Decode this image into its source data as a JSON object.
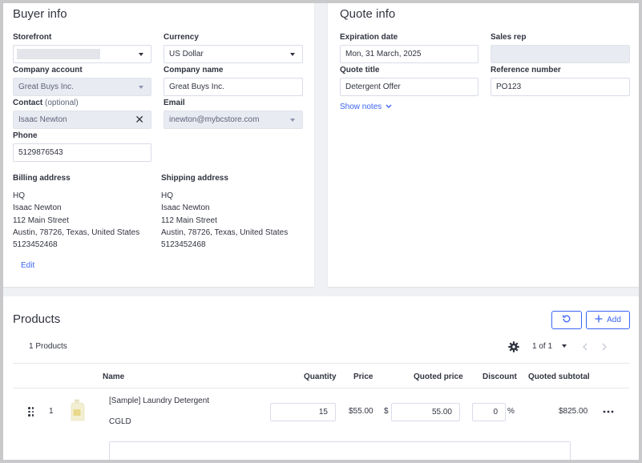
{
  "buyer": {
    "title": "Buyer info",
    "storefront_label": "Storefront",
    "currency_label": "Currency",
    "currency_value": "US Dollar",
    "company_account_label": "Company account",
    "company_account_value": "Great Buys Inc.",
    "company_name_label": "Company name",
    "company_name_value": "Great Buys Inc.",
    "contact_label": "Contact",
    "contact_optional": "(optional)",
    "contact_value": "Isaac Newton",
    "email_label": "Email",
    "email_value": "inewton@mybcstore.com",
    "phone_label": "Phone",
    "phone_value": "5129876543",
    "billing_label": "Billing address",
    "shipping_label": "Shipping address",
    "billing": [
      "HQ",
      "Isaac Newton",
      "112 Main Street",
      "Austin, 78726, Texas, United States",
      "5123452468"
    ],
    "shipping": [
      "HQ",
      "Isaac Newton",
      "112 Main Street",
      "Austin, 78726, Texas, United States",
      "5123452468"
    ],
    "edit_label": "Edit"
  },
  "quote": {
    "title": "Quote info",
    "expiration_label": "Expiration date",
    "expiration_value": "Mon, 31 March, 2025",
    "sales_rep_label": "Sales rep",
    "quote_title_label": "Quote title",
    "quote_title_value": "Detergent Offer",
    "reference_label": "Reference number",
    "reference_value": "PO123",
    "show_notes": "Show notes"
  },
  "products": {
    "title": "Products",
    "add_label": "Add",
    "count_text": "1 Products",
    "pagination": "1 of 1",
    "columns": {
      "name": "Name",
      "quantity": "Quantity",
      "price": "Price",
      "quoted_price": "Quoted price",
      "discount": "Discount",
      "quoted_subtotal": "Quoted subtotal"
    },
    "rows": [
      {
        "index": "1",
        "name": "[Sample] Laundry Detergent",
        "sku": "CGLD",
        "quantity": "15",
        "price": "$55.00",
        "currency_symbol": "$",
        "quoted_price": "55.00",
        "discount": "0",
        "percent": "%",
        "subtotal": "$825.00"
      }
    ]
  },
  "icons": {
    "clear": "close-icon",
    "refresh": "refresh-icon",
    "add": "plus-icon",
    "settings": "gear-icon",
    "prev": "chevron-left-icon",
    "next": "chevron-right-icon",
    "drag": "drag-handle-icon",
    "more": "more-horizontal-icon"
  },
  "colors": {
    "accent": "#3c64f4",
    "text": "#313440",
    "disabled_bg": "#e9ebf2",
    "page_bg": "#f0f1f5"
  }
}
